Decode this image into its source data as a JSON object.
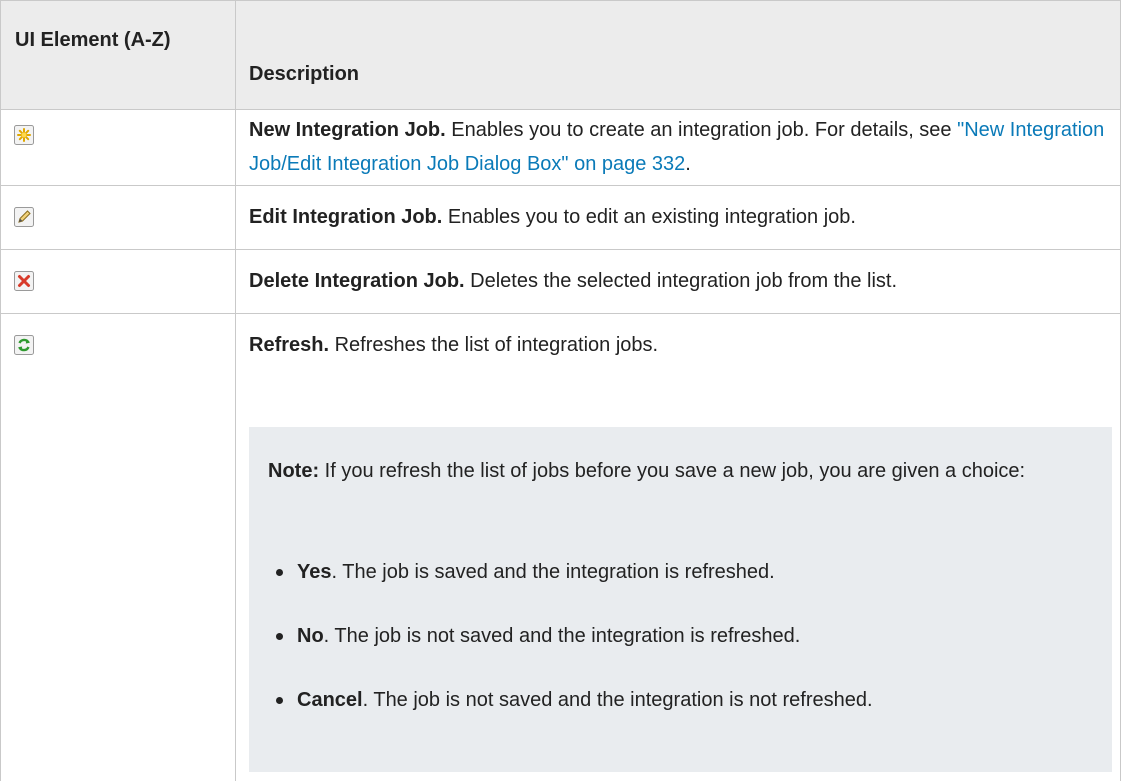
{
  "header": {
    "ui_element": "UI Element (A-Z)",
    "description": "Description"
  },
  "rows": [
    {
      "icon": "new-star-icon",
      "title": "New Integration Job.",
      "text": " Enables you to create an integration job. For details, see ",
      "link": "\"New Integration Job/Edit Integration Job Dialog Box\" on page 332",
      "after": "."
    },
    {
      "icon": "edit-pencil-icon",
      "title": "Edit Integration Job.",
      "text": " Enables you to edit an existing integration job."
    },
    {
      "icon": "delete-x-icon",
      "title": "Delete Integration Job.",
      "text": " Deletes the selected integration job from the list."
    },
    {
      "icon": "refresh-icon",
      "title": "Refresh.",
      "text": " Refreshes the list of integration jobs."
    }
  ],
  "note": {
    "label": "Note:",
    "text": " If you refresh the list of jobs before you save a new job, you are given a choice:",
    "bullets": [
      {
        "label": "Yes",
        "text": ". The job is saved and the integration is refreshed."
      },
      {
        "label": "No",
        "text": ". The job is not saved and the integration is refreshed."
      },
      {
        "label": "Cancel",
        "text": ". The job is not saved and the integration is not refreshed."
      }
    ]
  }
}
